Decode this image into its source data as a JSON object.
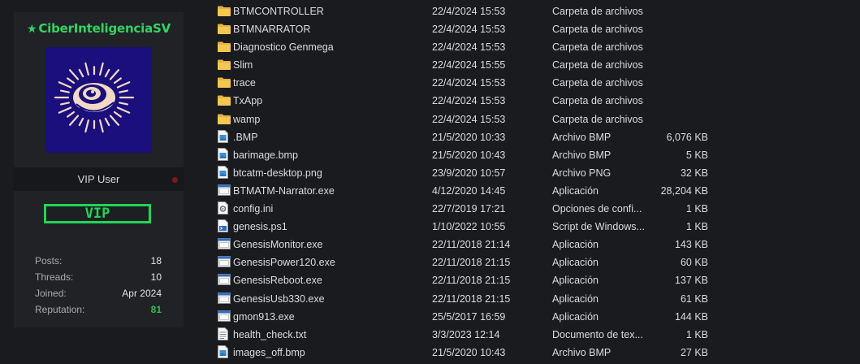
{
  "profile": {
    "username": "CiberInteligenciaSV",
    "role": "VIP User",
    "badge": "VIP",
    "stats": [
      {
        "label": "Posts:",
        "value": "18",
        "highlight": false
      },
      {
        "label": "Threads:",
        "value": "10",
        "highlight": false
      },
      {
        "label": "Joined:",
        "value": "Apr 2024",
        "highlight": false
      },
      {
        "label": "Reputation:",
        "value": "81",
        "highlight": true
      }
    ],
    "colors": {
      "accent": "#1fd655",
      "avatar_bg": "#1a0f7c"
    }
  },
  "files": [
    {
      "name": "BTMCONTROLLER",
      "date": "22/4/2024 15:53",
      "type": "Carpeta de archivos",
      "size": "",
      "icon": "folder"
    },
    {
      "name": "BTMNARRATOR",
      "date": "22/4/2024 15:53",
      "type": "Carpeta de archivos",
      "size": "",
      "icon": "folder"
    },
    {
      "name": "Diagnostico Genmega",
      "date": "22/4/2024 15:53",
      "type": "Carpeta de archivos",
      "size": "",
      "icon": "folder"
    },
    {
      "name": "Slim",
      "date": "22/4/2024 15:55",
      "type": "Carpeta de archivos",
      "size": "",
      "icon": "folder"
    },
    {
      "name": "trace",
      "date": "22/4/2024 15:53",
      "type": "Carpeta de archivos",
      "size": "",
      "icon": "folder"
    },
    {
      "name": "TxApp",
      "date": "22/4/2024 15:53",
      "type": "Carpeta de archivos",
      "size": "",
      "icon": "folder"
    },
    {
      "name": "wamp",
      "date": "22/4/2024 15:53",
      "type": "Carpeta de archivos",
      "size": "",
      "icon": "folder"
    },
    {
      "name": ".BMP",
      "date": "21/5/2020 10:33",
      "type": "Archivo BMP",
      "size": "6,076 KB",
      "icon": "image"
    },
    {
      "name": "barimage.bmp",
      "date": "21/5/2020 10:43",
      "type": "Archivo BMP",
      "size": "5 KB",
      "icon": "image"
    },
    {
      "name": "btcatm-desktop.png",
      "date": "23/9/2020 10:57",
      "type": "Archivo PNG",
      "size": "32 KB",
      "icon": "image"
    },
    {
      "name": "BTMATM-Narrator.exe",
      "date": "4/12/2020 14:45",
      "type": "Aplicación",
      "size": "28,204 KB",
      "icon": "exe"
    },
    {
      "name": "config.ini",
      "date": "22/7/2019 17:21",
      "type": "Opciones de confi...",
      "size": "1 KB",
      "icon": "ini"
    },
    {
      "name": "genesis.ps1",
      "date": "1/10/2022 10:55",
      "type": "Script de Windows...",
      "size": "1 KB",
      "icon": "script"
    },
    {
      "name": "GenesisMonitor.exe",
      "date": "22/11/2018 21:14",
      "type": "Aplicación",
      "size": "143 KB",
      "icon": "exe"
    },
    {
      "name": "GenesisPower120.exe",
      "date": "22/11/2018 21:15",
      "type": "Aplicación",
      "size": "60 KB",
      "icon": "exe"
    },
    {
      "name": "GenesisReboot.exe",
      "date": "22/11/2018 21:15",
      "type": "Aplicación",
      "size": "137 KB",
      "icon": "exe"
    },
    {
      "name": "GenesisUsb330.exe",
      "date": "22/11/2018 21:15",
      "type": "Aplicación",
      "size": "61 KB",
      "icon": "exe"
    },
    {
      "name": "gmon913.exe",
      "date": "25/5/2017 16:59",
      "type": "Aplicación",
      "size": "144 KB",
      "icon": "exe"
    },
    {
      "name": "health_check.txt",
      "date": "3/3/2023 12:14",
      "type": "Documento de tex...",
      "size": "1 KB",
      "icon": "text"
    },
    {
      "name": "images_off.bmp",
      "date": "21/5/2020 10:43",
      "type": "Archivo BMP",
      "size": "27 KB",
      "icon": "image"
    }
  ]
}
